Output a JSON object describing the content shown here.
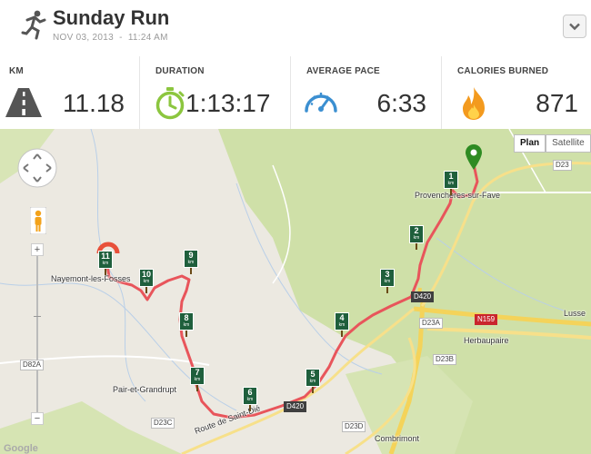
{
  "header": {
    "title": "Sunday Run",
    "date": "NOV 03, 2013",
    "separator": "-",
    "time": "11:24 AM",
    "icon": "runner-icon",
    "menu_icon": "chevron-down-icon"
  },
  "stats": [
    {
      "label": "KM",
      "value": "11.18",
      "icon": "road-icon"
    },
    {
      "label": "DURATION",
      "value": "1:13:17",
      "icon": "stopwatch-icon"
    },
    {
      "label": "AVERAGE PACE",
      "value": "6:33",
      "icon": "speedometer-icon"
    },
    {
      "label": "CALORIES BURNED",
      "value": "871",
      "icon": "flame-icon"
    }
  ],
  "map": {
    "type_buttons": [
      "Plan",
      "Satellite"
    ],
    "active_type": "Plan",
    "places": [
      "Provenchères-sur-Fave",
      "Nayemont-les-Fosses",
      "Pair-et-Grandrupt",
      "Herbaupaire",
      "Combrimont",
      "Lusse"
    ],
    "road_labels": [
      "D23",
      "D420",
      "D23A",
      "N159",
      "D23B",
      "D420",
      "D23C",
      "D23D",
      "D82A"
    ],
    "street": "Route de Saint-Dié",
    "km_markers": [
      "1",
      "2",
      "3",
      "4",
      "5",
      "6",
      "7",
      "8",
      "9",
      "10",
      "11"
    ],
    "km_unit": "km",
    "watermark": "Google",
    "zoom_in": "+",
    "zoom_out": "−",
    "colors": {
      "route": "#e8555b",
      "forest": "#cfe0a8",
      "road_yellow": "#f4d35a",
      "start_pin": "#2e8b22",
      "end_pin": "#e8503a",
      "km_marker": "#1f5f3c"
    }
  }
}
